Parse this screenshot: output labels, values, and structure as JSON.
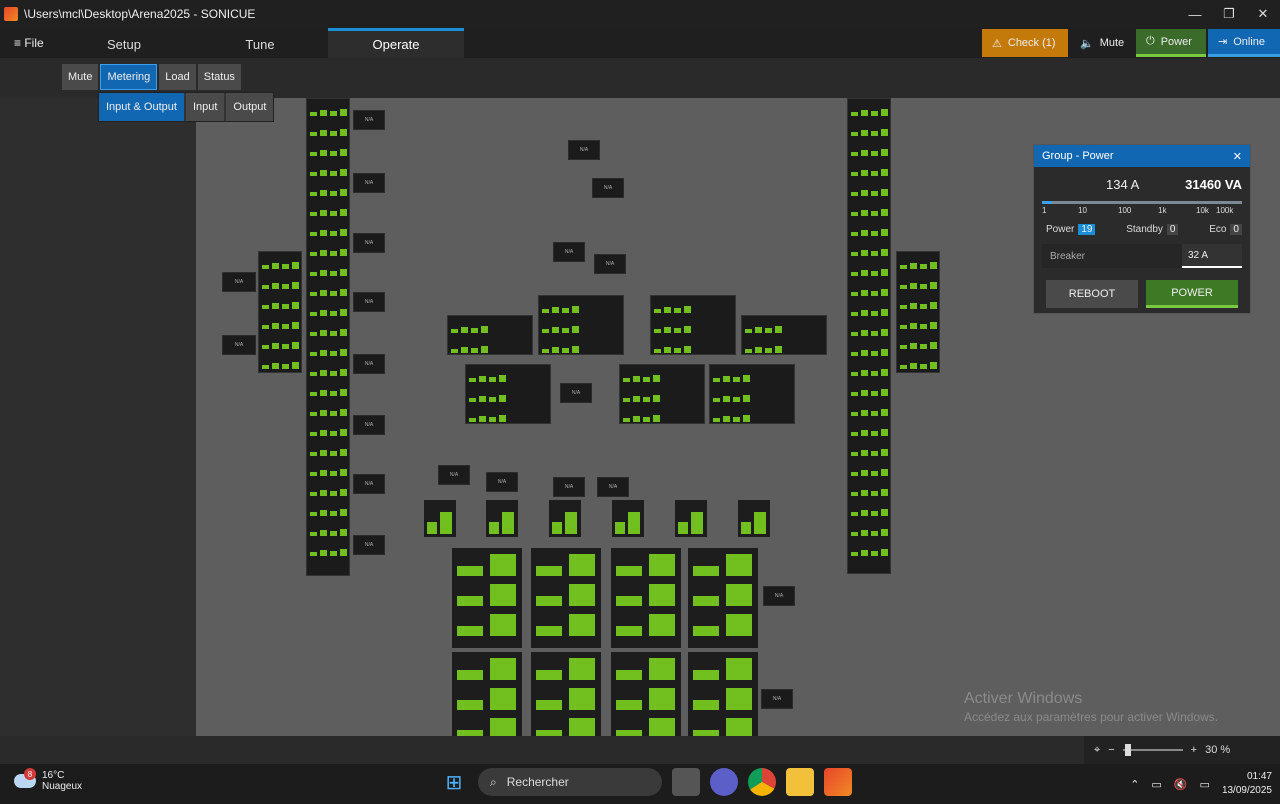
{
  "window": {
    "title": "\\Users\\mcl\\Desktop\\Arena2025 - SONICUE",
    "minimize": "—",
    "restore": "❐",
    "close": "✕"
  },
  "menu": {
    "file": "≡ File",
    "tabs": [
      "Setup",
      "Tune",
      "Operate"
    ],
    "active_tab": "Operate"
  },
  "topright": {
    "check": "Check (1)",
    "mute": "Mute",
    "power": "Power",
    "online": "Online"
  },
  "subtabs": [
    "Mute",
    "Metering",
    "Load",
    "Status"
  ],
  "subtabs2": [
    "Input & Output",
    "Input",
    "Output"
  ],
  "na_label": "N/A",
  "group_panel": {
    "title": "Group - Power",
    "current": "134 A",
    "power_va": "31460 VA",
    "scale": [
      "1",
      "10",
      "100",
      "1k",
      "10k",
      "100k"
    ],
    "scale_fill_fraction": 0.05,
    "counts": {
      "power_label": "Power",
      "power": "19",
      "standby_label": "Standby",
      "standby": "0",
      "eco_label": "Eco",
      "eco": "0"
    },
    "breaker_label": "Breaker",
    "breaker_value": "32 A",
    "reboot": "REBOOT",
    "power_btn": "POWER"
  },
  "zoom": {
    "minus": "−",
    "plus": "+",
    "value": "30 %"
  },
  "watermark": {
    "line1": "Activer Windows",
    "line2": "Accédez aux paramètres pour activer Windows."
  },
  "taskbar": {
    "temp": "16°C",
    "weather": "Nuageux",
    "badge": "8",
    "search": "Rechercher",
    "time": "01:47",
    "date": "13/09/2025"
  },
  "colors": {
    "accent": "#1167b1",
    "meter": "#72c01f",
    "warning": "#c47a0a"
  }
}
